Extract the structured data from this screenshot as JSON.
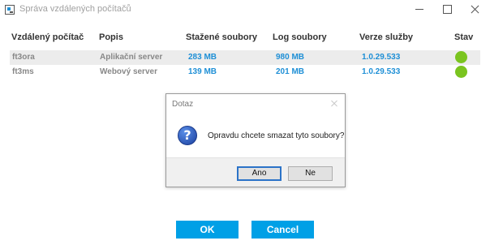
{
  "window": {
    "title": "Správa vzdálených počítačů"
  },
  "table": {
    "columns": [
      "Vzdálený počítač",
      "Popis",
      "Stažené soubory",
      "Log soubory",
      "Verze služby",
      "Stav"
    ],
    "rows": [
      {
        "computer": "ft3ora",
        "description": "Aplikační server",
        "downloaded": "283 MB",
        "logs": "980 MB",
        "version": "1.0.29.533",
        "status": "online",
        "selected": true
      },
      {
        "computer": "ft3ms",
        "description": "Webový server",
        "downloaded": "139 MB",
        "logs": "201 MB",
        "version": "1.0.29.533",
        "status": "online",
        "selected": false
      }
    ]
  },
  "dialog": {
    "title": "Dotaz",
    "message": "Opravdu chcete smazat tyto soubory?",
    "icon": "question-icon",
    "yes_label": "Ano",
    "no_label": "Ne"
  },
  "footer": {
    "ok_label": "OK",
    "cancel_label": "Cancel"
  },
  "colors": {
    "accent": "#00a0e6",
    "link": "#1e8fd6",
    "status_ok": "#7ac41f"
  }
}
